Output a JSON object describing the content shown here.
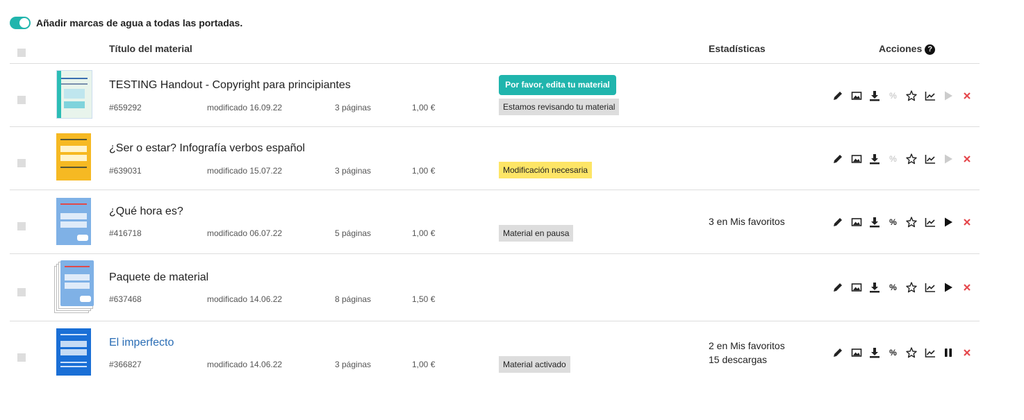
{
  "watermark": {
    "label": "Añadir marcas de agua a todas las portadas."
  },
  "header": {
    "title_col": "Título del material",
    "stats_col": "Estadísticas",
    "actions_col": "Acciones",
    "help": "?"
  },
  "rows": [
    {
      "title": "TESTING Handout - Copyright para principiantes",
      "id": "#659292",
      "modified": "modificado 16.09.22",
      "pages": "3 páginas",
      "price": "1,00 €",
      "button": "Por favor, edita tu material",
      "status": "Estamos revisando tu material",
      "stats1": "",
      "stats2": ""
    },
    {
      "title": "¿Ser o estar? Infografía verbos español",
      "id": "#639031",
      "modified": "modificado 15.07.22",
      "pages": "3 páginas",
      "price": "1,00 €",
      "status": "Modificación necesaria",
      "stats1": "",
      "stats2": ""
    },
    {
      "title": "¿Qué hora es?",
      "id": "#416718",
      "modified": "modificado 06.07.22",
      "pages": "5 páginas",
      "price": "1,00 €",
      "status": "Material en pausa",
      "stats1": "3 en Mis favoritos",
      "stats2": ""
    },
    {
      "title": "Paquete de material",
      "id": "#637468",
      "modified": "modificado 14.06.22",
      "pages": "8 páginas",
      "price": "1,50 €",
      "status": "",
      "stats1": "",
      "stats2": ""
    },
    {
      "title": "El imperfecto",
      "id": "#366827",
      "modified": "modificado 14.06.22",
      "pages": "3 páginas",
      "price": "1,00 €",
      "status": "Material activado",
      "stats1": "2 en Mis favoritos",
      "stats2": "15 descargas"
    }
  ],
  "icons": {
    "edit": "pencil-icon",
    "image": "image-icon",
    "download": "download-icon",
    "discount": "percent-icon",
    "favorite": "star-icon",
    "stats": "chart-icon",
    "play": "play-icon",
    "pause": "pause-icon",
    "delete": "close-icon",
    "percent_glyph": "%"
  },
  "colors": {
    "accent": "#20b5ad",
    "warning": "#fde566",
    "delete": "#e5484d",
    "link": "#2a6db5"
  }
}
